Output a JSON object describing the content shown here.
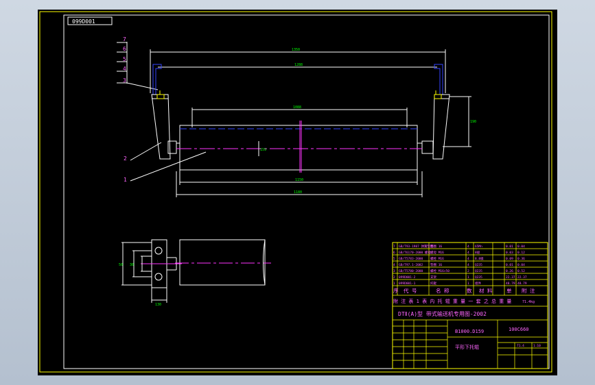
{
  "drawing": {
    "drawing_number": "099D001",
    "frame_color": "#ffff00",
    "colors": {
      "outline": "#00ff00",
      "white": "#ffffff",
      "blue": "#3344ff",
      "center": "#ff33ff",
      "text_magenta": "#ff66ff",
      "dim": "#00ff00"
    }
  },
  "callouts": {
    "left_stack": [
      "7",
      "6",
      "5",
      "4",
      "3"
    ],
    "part2": "2",
    "part1": "1"
  },
  "dimensions": {
    "d1": "1350",
    "d2": "1288",
    "d3": "1088",
    "d4": "1150",
    "d5": "1180",
    "d6": "1287",
    "d7": "190",
    "d8": "159"
  },
  "side_view_dims": {
    "v1": "50",
    "v2": "30",
    "h1": "130"
  },
  "title_block": {
    "parts_rows": [
      [
        "7",
        "GB/T93-1987 弹簧垫圈",
        "垫圈 16",
        "4",
        "65Mn",
        "0.01",
        "0.04"
      ],
      [
        "6",
        "GB/T6170-2000 螺母",
        "螺母 M16",
        "4",
        "8级",
        "0.03",
        "0.12"
      ],
      [
        "5",
        "GB/T5783-2000",
        "螺栓 M16",
        "4",
        "8.8级",
        "0.09",
        "0.36"
      ],
      [
        "4",
        "GB/T97.1-2002",
        "垫圈 16",
        "4",
        "Q235",
        "0.01",
        "0.04"
      ],
      [
        "3",
        "GB/T5780-2000",
        "螺栓 M16×50",
        "2",
        "Q235",
        "0.26",
        "0.52"
      ],
      [
        "2",
        "099D001-2",
        "支架",
        "1",
        "Q235",
        "22.37",
        "22.37"
      ],
      [
        "1",
        "099D001-1",
        "托辊",
        "1",
        "组件",
        "48.79",
        "48.79"
      ]
    ],
    "header": {
      "c1": "序",
      "c2": "代  号",
      "c3": "名  称",
      "c4": "数",
      "c5": "材  料",
      "c6": "单",
      "c7": "附  注"
    },
    "mass_note": "附 注 表 1 表 内 托 辊 重 量 一 套 之 总 重 量",
    "mass_value": "71.4kg",
    "standard": "DTⅡ(A)型 带式输送机专用图-2002",
    "model": "B1000.D159",
    "code": "100C660",
    "name": "平形下托辊",
    "small_values": [
      "71.4",
      "1:10"
    ]
  }
}
